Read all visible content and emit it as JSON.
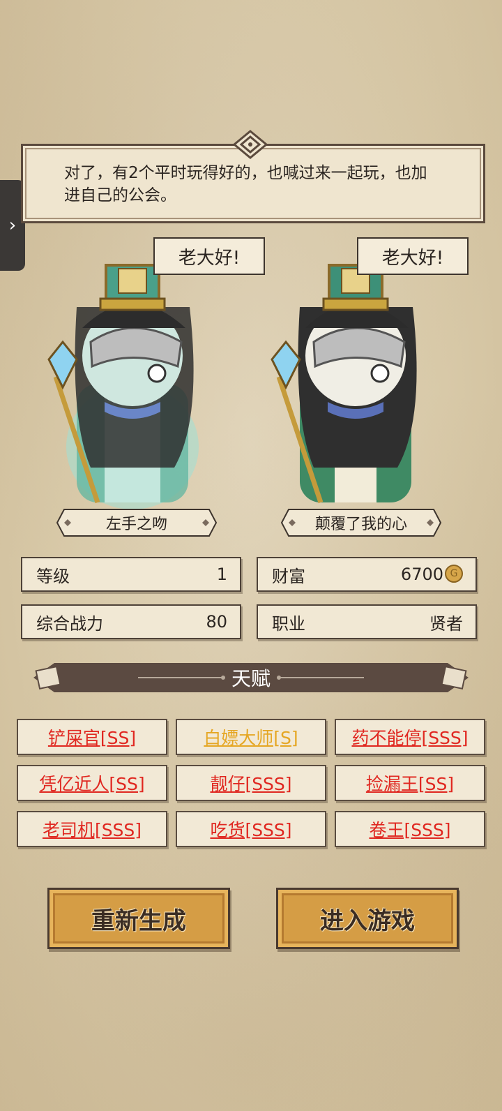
{
  "dialog": {
    "text": "对了，有2个平时玩得好的，也喊过来一起玩，也加进自己的公会。"
  },
  "characters": [
    {
      "speech": "老大好!",
      "name": "左手之吻"
    },
    {
      "speech": "老大好!",
      "name": "颠覆了我的心"
    }
  ],
  "stats": {
    "level_label": "等级",
    "level_value": "1",
    "wealth_label": "财富",
    "wealth_value": "6700",
    "power_label": "综合战力",
    "power_value": "80",
    "job_label": "职业",
    "job_value": "贤者"
  },
  "talents": {
    "title": "天赋",
    "items": [
      {
        "label": "铲屎官[SS]",
        "color": "#e02720"
      },
      {
        "label": "白嫖大师[S]",
        "color": "#e5a623"
      },
      {
        "label": "药不能停[SSS]",
        "color": "#e02720"
      },
      {
        "label": "凭亿近人[SS]",
        "color": "#e02720"
      },
      {
        "label": "靓仔[SSS]",
        "color": "#e02720"
      },
      {
        "label": "捡漏王[SS]",
        "color": "#e02720"
      },
      {
        "label": "老司机[SSS]",
        "color": "#e02720"
      },
      {
        "label": "吃货[SSS]",
        "color": "#e02720"
      },
      {
        "label": "卷王[SSS]",
        "color": "#e02720"
      }
    ]
  },
  "buttons": {
    "regenerate": "重新生成",
    "enter": "进入游戏"
  },
  "icons": {
    "side_tab": "chevron-right-icon",
    "coin": "gold-coin-icon"
  }
}
